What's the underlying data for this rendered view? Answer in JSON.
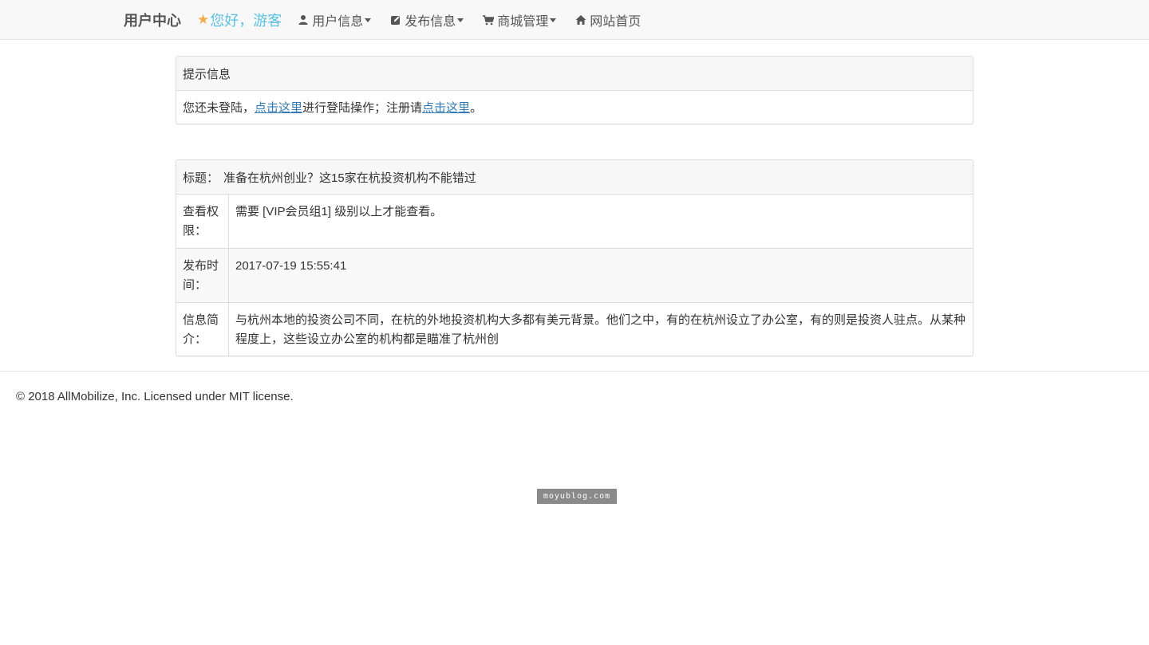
{
  "navbar": {
    "brand": "用户中心",
    "greeting": "您好，游客",
    "items": [
      {
        "label": "用户信息",
        "icon": "user-icon",
        "dropdown": true
      },
      {
        "label": "发布信息",
        "icon": "edit-icon",
        "dropdown": true
      },
      {
        "label": "商城管理",
        "icon": "cart-icon",
        "dropdown": true
      },
      {
        "label": "网站首页",
        "icon": "home-icon",
        "dropdown": false
      }
    ]
  },
  "notice": {
    "heading": "提示信息",
    "text_before": "您还未登陆，",
    "login_link": "点击这里",
    "text_middle": "进行登陆操作；注册请",
    "register_link": "点击这里",
    "text_after": "。"
  },
  "article": {
    "title_label": "标题：",
    "title": "准备在杭州创业？这15家在杭投资机构不能错过",
    "rows": [
      {
        "label": "查看权限：",
        "value": "需要 [VIP会员组1] 级别以上才能查看。"
      },
      {
        "label": "发布时间：",
        "value": "2017-07-19 15:55:41"
      },
      {
        "label": "信息简介：",
        "value": "与杭州本地的投资公司不同，在杭的外地投资机构大多都有美元背景。他们之中，有的在杭州设立了办公室，有的则是投资人驻点。从某种程度上，这些设立办公室的机构都是瞄准了杭州创"
      }
    ]
  },
  "footer": {
    "text": "© 2018 AllMobilize, Inc. Licensed under MIT license."
  },
  "watermark": "moyublog.com",
  "colors": {
    "link": "#337ab7",
    "greeting": "#5bc0de",
    "star": "#f0ad4e",
    "navbar_bg": "#f8f8f8"
  }
}
